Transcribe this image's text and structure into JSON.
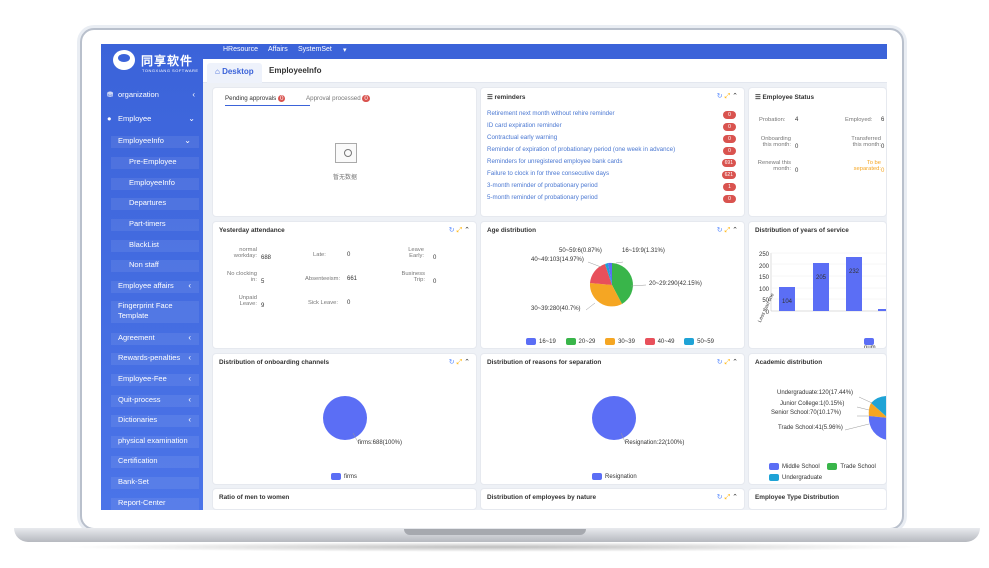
{
  "brand": {
    "name": "同享软件",
    "subtitle": "TONGXIANG SOFTWARE"
  },
  "top_nav": [
    "HResource",
    "Affairs",
    "SystemSet"
  ],
  "tabs": [
    "Desktop",
    "EmployeeInfo"
  ],
  "sidebar": [
    {
      "label": "organization"
    },
    {
      "label": "Employee"
    },
    {
      "label": "EmployeeInfo"
    },
    {
      "label": "Pre-Employee"
    },
    {
      "label": "EmployeeInfo"
    },
    {
      "label": "Departures"
    },
    {
      "label": "Part-timers"
    },
    {
      "label": "BlackList"
    },
    {
      "label": "Non staff"
    },
    {
      "label": "Employee affairs"
    },
    {
      "label": "Fingerprint Face Template"
    },
    {
      "label": "Agreement"
    },
    {
      "label": "Rewards-penalties"
    },
    {
      "label": "Employee-Fee"
    },
    {
      "label": "Quit-process"
    },
    {
      "label": "Dictionaries"
    },
    {
      "label": "physical examination"
    },
    {
      "label": "Certification"
    },
    {
      "label": "Bank-Set"
    },
    {
      "label": "Report-Center"
    }
  ],
  "approvals": {
    "pending": "Pending approvals",
    "pending_count": "0",
    "processed": "Approval processed",
    "processed_count": "0",
    "empty": "暂无数据"
  },
  "reminders": {
    "title": "reminders",
    "items": [
      {
        "text": "Retirement next month without rehire reminder",
        "count": "0"
      },
      {
        "text": "ID card expiration reminder",
        "count": "0"
      },
      {
        "text": "Contractual early warning",
        "count": "0"
      },
      {
        "text": "Reminder of expiration of probationary period (one week in advance)",
        "count": "0"
      },
      {
        "text": "Reminders for unregistered employee bank cards",
        "count": "691"
      },
      {
        "text": "Failure to clock in for three consecutive days",
        "count": "621"
      },
      {
        "text": "3-month reminder of probationary period",
        "count": "1"
      },
      {
        "text": "5-month reminder of probationary period",
        "count": "0"
      }
    ]
  },
  "employee_status": {
    "title": "Employee Status",
    "probation_label": "Probation:",
    "probation": "4",
    "employed_label": "Employed:",
    "employed": "6",
    "onboarding_label": "Onboarding this month:",
    "onboarding": "0",
    "transferred_label": "Transferred this month:",
    "transferred": "0",
    "renewal_label": "Renewal this month:",
    "renewal": "0",
    "separated_label": "To be separated:",
    "separated": "0"
  },
  "attendance": {
    "title": "Yesterday attendance",
    "normal_label": "normal workday:",
    "normal": "688",
    "late_label": "Late:",
    "late": "0",
    "leave_early_label": "Leave Early:",
    "leave_early": "0",
    "no_clock_label": "No clocking in:",
    "no_clock": "5",
    "absenteeism_label": "Absenteeism:",
    "absenteeism": "661",
    "business_label": "Business Trip:",
    "business": "0",
    "unpaid_label": "Unpaid Leave:",
    "unpaid": "9",
    "sick_label": "Sick Leave:",
    "sick": "0"
  },
  "age": {
    "title": "Age distribution",
    "labels": [
      "50~59:6(0.87%)",
      "16~19:9(1.31%)",
      "40~49:103(14.97%)",
      "20~29:290(42.15%)",
      "30~39:280(40.7%)"
    ],
    "legend": [
      "16~19",
      "20~29",
      "30~39",
      "40~49",
      "50~59"
    ]
  },
  "service": {
    "title": "Distribution of years of service",
    "yaxis": [
      "250",
      "200",
      "150",
      "100",
      "50",
      "0"
    ],
    "bars": [
      "104",
      "205",
      "232"
    ],
    "xlabel": "Less than one",
    "legend": "num"
  },
  "onboarding": {
    "title": "Distribution of onboarding channels",
    "label": "firms:688(100%)",
    "legend": "firms"
  },
  "separation": {
    "title": "Distribution of reasons for separation",
    "label": "Resignation:22(100%)",
    "legend": "Resignation"
  },
  "academic": {
    "title": "Academic distribution",
    "labels": [
      "Undergraduate:120(17.44%)",
      "Junior College:1(0.15%)",
      "Senior School:70(10.17%)",
      "Trade School:41(5.96%)"
    ],
    "legend": [
      "Middle School",
      "Trade School",
      "Undergraduate"
    ]
  },
  "bottom": [
    "Ratio of men to women",
    "Distribution of employees by nature",
    "Employee Type Distribution"
  ],
  "colors": {
    "blue": "#5b6ef5",
    "green": "#39b54a",
    "orange": "#f5a623",
    "red": "#e8505b",
    "cyan": "#1fa3d6"
  }
}
